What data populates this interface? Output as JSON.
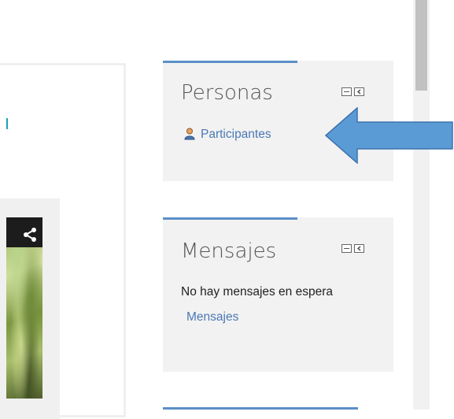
{
  "blocks": [
    {
      "title": "Personas",
      "link": "Participantes"
    },
    {
      "title": "Mensajes",
      "message": "No hay mensajes en espera",
      "link": "Mensajes"
    }
  ],
  "colors": {
    "accent": "#5b8fc7",
    "link": "#4a78b5",
    "arrow": "#5b9bd5",
    "block_bg": "#f2f2f2"
  },
  "icons": [
    "share-icon",
    "user-icon",
    "minimize-icon",
    "dock-icon",
    "arrow-annotation"
  ]
}
